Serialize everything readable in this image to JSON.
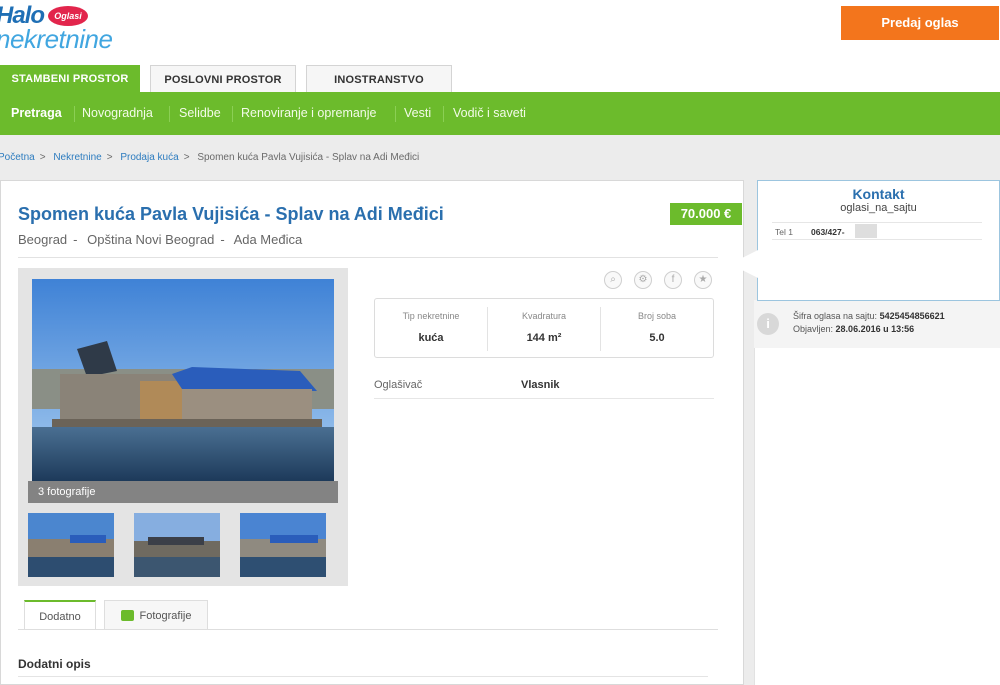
{
  "header": {
    "logo_halo": "Halo",
    "logo_badge": "Oglasi",
    "logo_nekretnine": "nekretnine",
    "post_ad_label": "Predaj oglas"
  },
  "category_tabs": [
    {
      "label": "STAMBENI PROSTOR",
      "active": true
    },
    {
      "label": "POSLOVNI PROSTOR",
      "active": false
    },
    {
      "label": "INOSTRANSTVO",
      "active": false
    }
  ],
  "subnav": [
    "Pretraga",
    "Novogradnja",
    "Selidbe",
    "Renoviranje i opremanje",
    "Vesti",
    "Vodič i saveti"
  ],
  "breadcrumb": [
    "Početna",
    "Nekretnine",
    "Prodaja kuća",
    "Spomen kuća Pavla Vujisića - Splav na Adi Međici"
  ],
  "listing": {
    "title": "Spomen kuća Pavla Vujisića - Splav na Adi Međici",
    "location": [
      "Beograd",
      "Opština Novi Beograd",
      "Ada Međica"
    ],
    "price": "70.000 €",
    "photo_count": "3 fotografije",
    "details": [
      {
        "label": "Tip nekretnine",
        "value": "kuća"
      },
      {
        "label": "Kvadratura",
        "value": "144 m²"
      },
      {
        "label": "Broj soba",
        "value": "5.0"
      }
    ],
    "advertiser_label": "Oglašivač",
    "advertiser_value": "Vlasnik"
  },
  "bottom_tabs": [
    {
      "label": "Dodatno",
      "active": true
    },
    {
      "label": "Fotografije",
      "active": false
    }
  ],
  "extra_description_heading": "Dodatni opis",
  "contact": {
    "title": "Kontakt",
    "username": "oglasi_na_sajtu",
    "tel_label": "Tel 1",
    "tel_number": "063/427-"
  },
  "meta": {
    "ad_code_label": "Šifra oglasa na sajtu:",
    "ad_code": "5425454856621",
    "published_label": "Objavljen:",
    "published": "28.06.2016 u 13:56"
  },
  "icons": [
    "zoom-icon",
    "settings-icon",
    "facebook-icon",
    "star-icon",
    "camera-icon",
    "info-icon"
  ],
  "colors": {
    "brand_green": "#6cbb2c",
    "brand_blue": "#2a6fae",
    "orange": "#f3751c"
  }
}
